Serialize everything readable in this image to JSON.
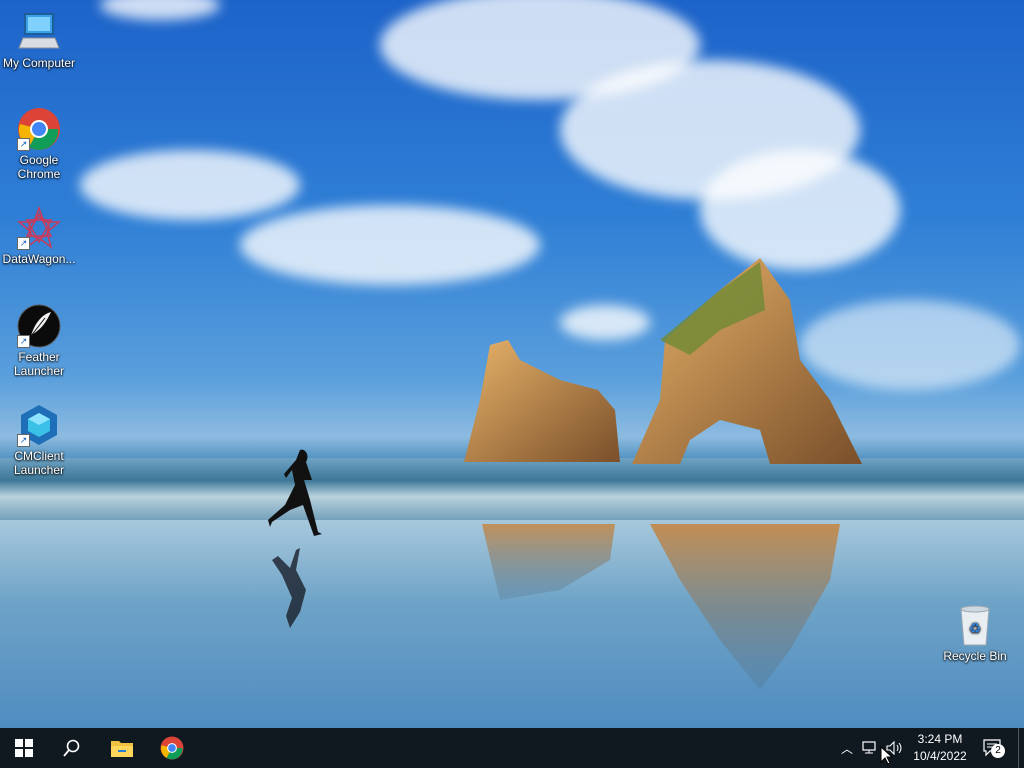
{
  "desktop": {
    "icons": [
      {
        "label": "My Computer"
      },
      {
        "label": "Google Chrome"
      },
      {
        "label": "DataWagon..."
      },
      {
        "label": "Feather Launcher"
      },
      {
        "label": "CMClient Launcher"
      },
      {
        "label": "Recycle Bin"
      }
    ]
  },
  "taskbar": {
    "time": "3:24 PM",
    "date": "10/4/2022",
    "notification_count": "2"
  },
  "colors": {
    "taskbar_bg": "#101820",
    "accent": "#1a73e8"
  }
}
